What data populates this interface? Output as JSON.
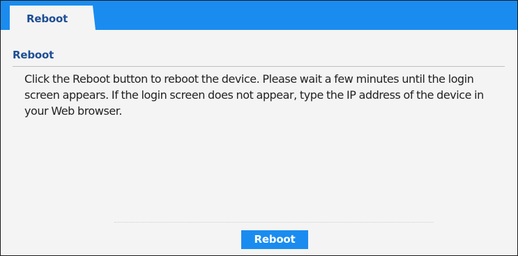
{
  "tabs": [
    {
      "label": "Reboot",
      "active": true
    }
  ],
  "section": {
    "title": "Reboot",
    "description": "Click the Reboot button to reboot the device. Please wait a few minutes until the login screen appears. If the login screen does not appear, type the IP address of the device in your Web browser."
  },
  "actions": {
    "reboot_label": "Reboot"
  },
  "colors": {
    "accent": "#1a8cf0",
    "heading": "#1d4e94",
    "panel_background": "#f4f4f4"
  }
}
